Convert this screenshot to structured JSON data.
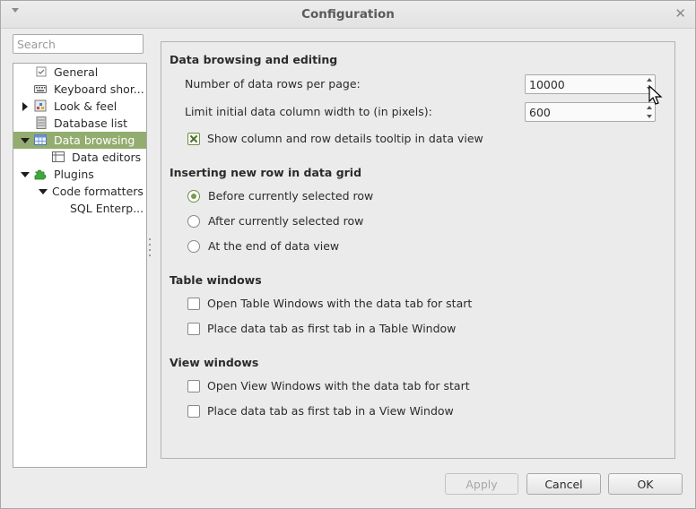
{
  "window": {
    "title": "Configuration"
  },
  "search": {
    "placeholder": "Search"
  },
  "tree": {
    "items": [
      {
        "label": "General"
      },
      {
        "label": "Keyboard shor..."
      },
      {
        "label": "Look & feel"
      },
      {
        "label": "Database list"
      },
      {
        "label": "Data browsing"
      },
      {
        "label": "Data editors"
      },
      {
        "label": "Plugins"
      },
      {
        "label": "Code formatters"
      },
      {
        "label": "SQL Enterp..."
      }
    ]
  },
  "sections": {
    "data_browsing": {
      "heading": "Data browsing and editing",
      "rows_per_page_label": "Number of data rows per page:",
      "rows_per_page_value": "10000",
      "col_width_label": "Limit initial data column width to (in pixels):",
      "col_width_value": "600",
      "tooltip_label": "Show column and row details tooltip in data view"
    },
    "inserting": {
      "heading": "Inserting new row in data grid",
      "options": [
        "Before currently selected row",
        "After currently selected row",
        "At the end of data view"
      ]
    },
    "table_windows": {
      "heading": "Table windows",
      "options": [
        "Open Table Windows with the data tab for start",
        "Place data tab as first tab in a Table Window"
      ]
    },
    "view_windows": {
      "heading": "View windows",
      "options": [
        "Open View Windows with the data tab for start",
        "Place data tab as first tab in a View Window"
      ]
    }
  },
  "buttons": {
    "apply": "Apply",
    "cancel": "Cancel",
    "ok": "OK"
  },
  "colors": {
    "selection": "#93ad70",
    "accent": "#6f8f4a"
  }
}
